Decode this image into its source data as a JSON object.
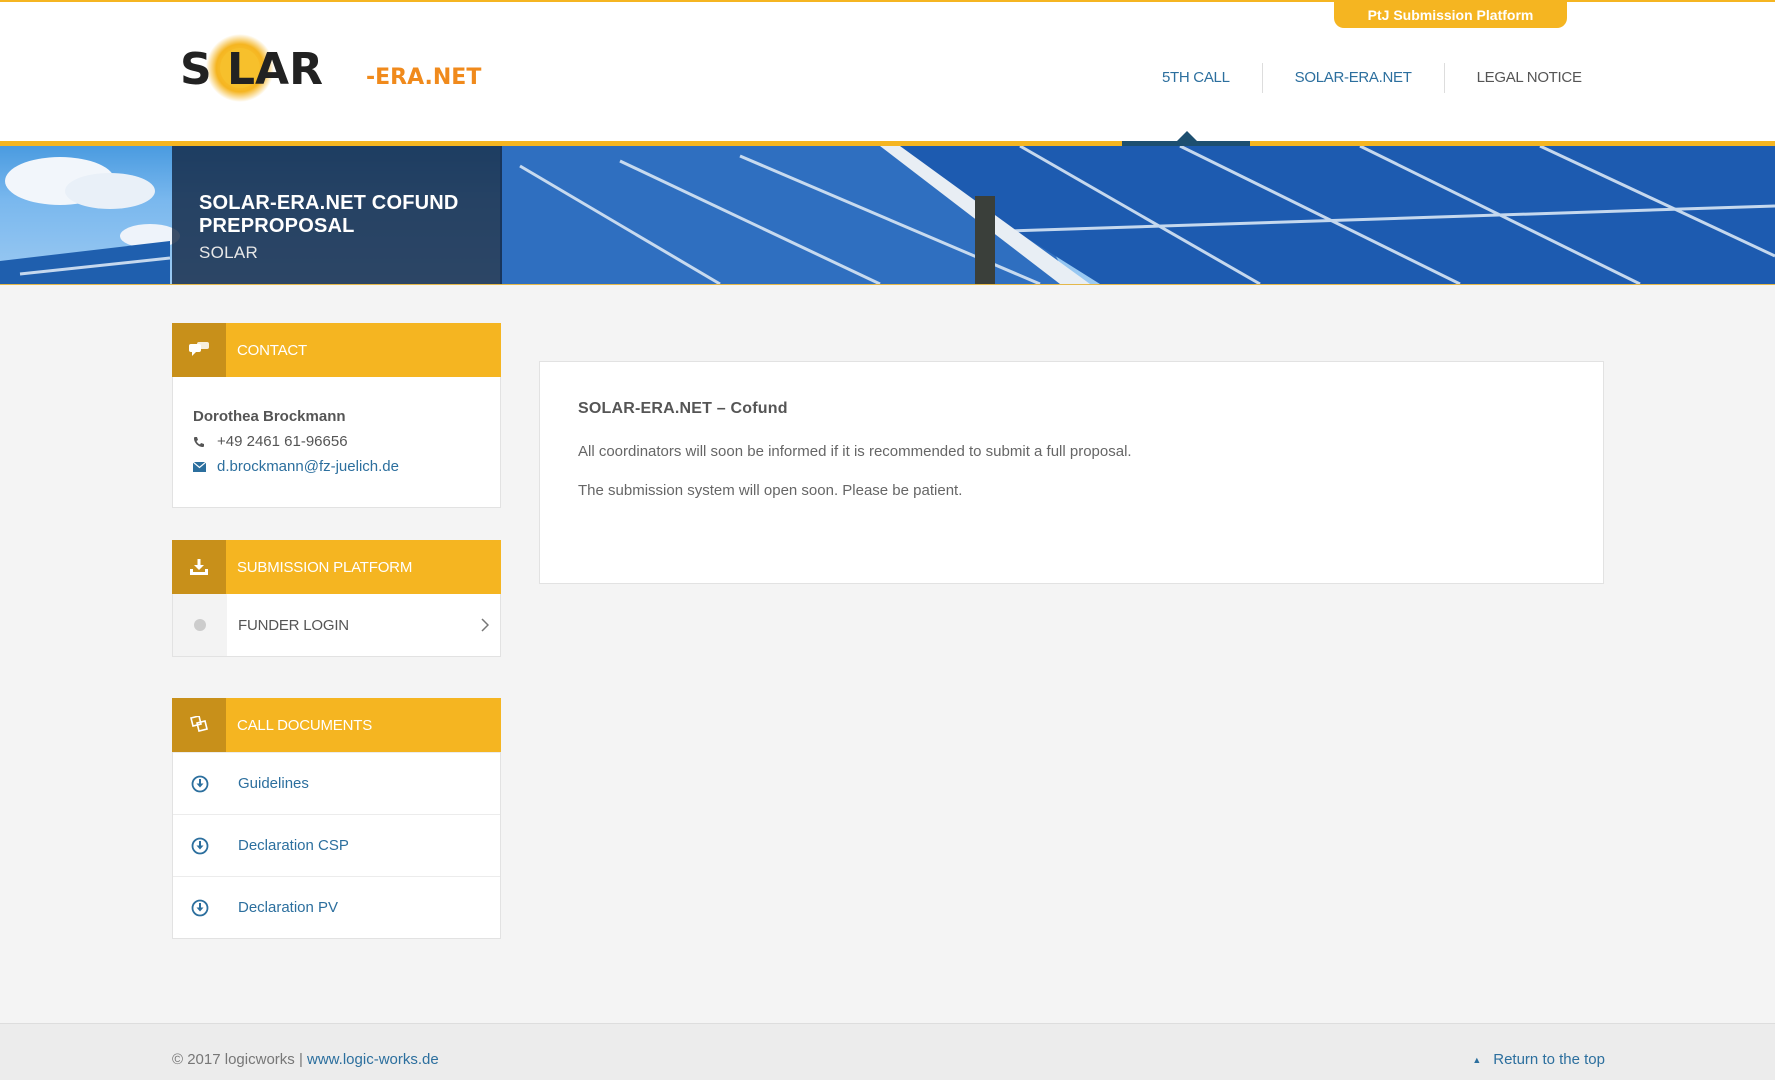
{
  "top_tab": {
    "label": "PtJ Submission Platform"
  },
  "logo": {
    "main": "S  LAR",
    "suffix": "-ERA.NET"
  },
  "nav": {
    "items": [
      {
        "label": "5TH CALL"
      },
      {
        "label": "SOLAR-ERA.NET"
      },
      {
        "label": "LEGAL NOTICE"
      }
    ]
  },
  "banner": {
    "title": "SOLAR-ERA.NET COFUND PREPROPOSAL",
    "subtitle": "SOLAR"
  },
  "contact": {
    "title": "CONTACT",
    "name": "Dorothea Brockmann",
    "phone": "+49 2461 61-96656",
    "email": "d.brockmann@fz-juelich.de"
  },
  "submission": {
    "title": "SUBMISSION PLATFORM",
    "items": [
      {
        "label": "FUNDER LOGIN"
      }
    ]
  },
  "documents": {
    "title": "CALL DOCUMENTS",
    "items": [
      {
        "label": "Guidelines"
      },
      {
        "label": "Declaration CSP"
      },
      {
        "label": "Declaration PV"
      }
    ]
  },
  "content": {
    "heading": "SOLAR-ERA.NET – Cofund",
    "paragraphs": [
      "All coordinators will soon be informed if it is recommended to submit a full proposal.",
      "The submission system will open soon. Please be patient."
    ]
  },
  "footer": {
    "copyright": "© 2017 logicworks | ",
    "link": "www.logic-works.de",
    "back_to_top": "Return to the top"
  },
  "colors": {
    "accent": "#f5b521",
    "accent_dark": "#c8901a",
    "link": "#2c6f9e",
    "navy": "#1d4f70"
  }
}
